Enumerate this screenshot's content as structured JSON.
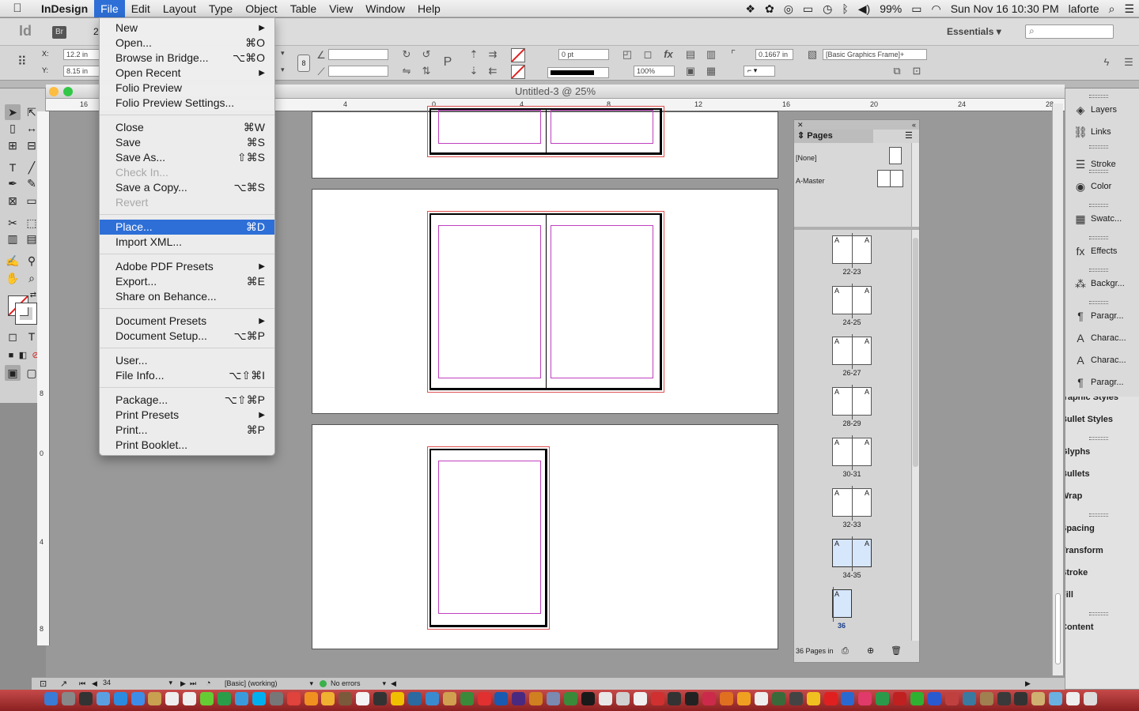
{
  "menubar": {
    "app_name": "InDesign",
    "items": [
      "File",
      "Edit",
      "Layout",
      "Type",
      "Object",
      "Table",
      "View",
      "Window",
      "Help"
    ],
    "status": {
      "battery": "99%",
      "clock": "Sun Nov 16  10:30 PM",
      "user": "laforte"
    }
  },
  "appbar": {
    "logo": "Id",
    "bridge": "Br",
    "zoom_partial": "2",
    "workspace": "Essentials",
    "search_placeholder": ""
  },
  "control_panel": {
    "x_label": "X:",
    "x_value": "12.2 in",
    "y_label": "Y:",
    "y_value": "8.15 in",
    "stroke_weight": "0 pt",
    "opacity": "100%",
    "fitting_value": "0.1667 in",
    "object_style": "[Basic Graphics Frame]+"
  },
  "document": {
    "title": "Untitled-3 @ 25%"
  },
  "ruler_h": [
    "16",
    "4",
    "0",
    "4",
    "8",
    "12",
    "16",
    "20",
    "24",
    "28"
  ],
  "ruler_v": [
    "8",
    "0",
    "4",
    "8"
  ],
  "file_menu": {
    "groups": [
      [
        {
          "label": "New",
          "shortcut": "",
          "submenu": true
        },
        {
          "label": "Open...",
          "shortcut": "⌘O"
        },
        {
          "label": "Browse in Bridge...",
          "shortcut": "⌥⌘O"
        },
        {
          "label": "Open Recent",
          "shortcut": "",
          "submenu": true
        },
        {
          "label": "Folio Preview",
          "shortcut": ""
        },
        {
          "label": "Folio Preview Settings...",
          "shortcut": ""
        }
      ],
      [
        {
          "label": "Close",
          "shortcut": "⌘W"
        },
        {
          "label": "Save",
          "shortcut": "⌘S"
        },
        {
          "label": "Save As...",
          "shortcut": "⇧⌘S"
        },
        {
          "label": "Check In...",
          "shortcut": "",
          "disabled": true
        },
        {
          "label": "Save a Copy...",
          "shortcut": "⌥⌘S"
        },
        {
          "label": "Revert",
          "shortcut": "",
          "disabled": true
        }
      ],
      [
        {
          "label": "Place...",
          "shortcut": "⌘D",
          "highlighted": true
        },
        {
          "label": "Import XML...",
          "shortcut": ""
        }
      ],
      [
        {
          "label": "Adobe PDF Presets",
          "shortcut": "",
          "submenu": true
        },
        {
          "label": "Export...",
          "shortcut": "⌘E"
        },
        {
          "label": "Share on Behance...",
          "shortcut": ""
        }
      ],
      [
        {
          "label": "Document Presets",
          "shortcut": "",
          "submenu": true
        },
        {
          "label": "Document Setup...",
          "shortcut": "⌥⌘P"
        }
      ],
      [
        {
          "label": "User...",
          "shortcut": ""
        },
        {
          "label": "File Info...",
          "shortcut": "⌥⇧⌘I"
        }
      ],
      [
        {
          "label": "Package...",
          "shortcut": "⌥⇧⌘P"
        },
        {
          "label": "Print Presets",
          "shortcut": "",
          "submenu": true
        },
        {
          "label": "Print...",
          "shortcut": "⌘P"
        },
        {
          "label": "Print Booklet...",
          "shortcut": ""
        }
      ]
    ]
  },
  "pages_panel": {
    "tab": "Pages",
    "masters": [
      {
        "label": "[None]"
      },
      {
        "label": "A-Master"
      }
    ],
    "spreads": [
      "22-23",
      "24-25",
      "26-27",
      "28-29",
      "30-31",
      "32-33",
      "34-35",
      "36"
    ],
    "master_letter": "A",
    "footer": "36 Pages in"
  },
  "dock_top": [
    {
      "label": "Layers",
      "icon": "layers-icon",
      "glyph": "◈"
    },
    {
      "label": "Links",
      "icon": "links-icon",
      "glyph": "⛓"
    },
    {
      "label": "Stroke",
      "icon": "stroke-icon",
      "glyph": "☰"
    },
    {
      "label": "Color",
      "icon": "color-icon",
      "glyph": "◉"
    },
    {
      "label": "Swatc...",
      "icon": "swatches-icon",
      "glyph": "▦"
    },
    {
      "label": "Effects",
      "icon": "effects-icon",
      "glyph": "fx"
    },
    {
      "label": "Backgr...",
      "icon": "background-tasks-icon",
      "glyph": "⁂"
    },
    {
      "label": "Paragr...",
      "icon": "paragraph-styles-icon",
      "glyph": "¶"
    },
    {
      "label": "Charac...",
      "icon": "character-icon",
      "glyph": "A"
    },
    {
      "label": "Charac...",
      "icon": "character-styles-icon",
      "glyph": "A"
    },
    {
      "label": "Paragr...",
      "icon": "paragraph-icon",
      "glyph": "¶"
    }
  ],
  "dock_bottom": [
    "Graphic Styles",
    "Bullet Styles",
    "Glyphs",
    "Bullets",
    "Wrap",
    "Spacing",
    "Transform",
    "Stroke",
    "Fill",
    "Content"
  ],
  "statusbar": {
    "page": "34",
    "profile": "[Basic] (working)",
    "errors": "No errors"
  },
  "colors": {
    "menu_highlight": "#2e6fd7",
    "margin_guide": "#c040c0",
    "bleed": "#e05050"
  }
}
